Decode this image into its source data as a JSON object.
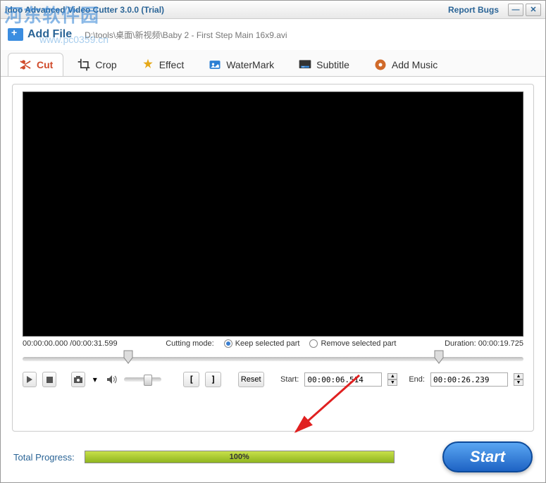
{
  "window": {
    "title": "idoo Advanced Video Cutter 3.0.0 (Trial)",
    "report_bugs": "Report Bugs"
  },
  "watermark": {
    "line1": "河东软件园",
    "line2": "www.pc0359.cn"
  },
  "toolbar": {
    "add_file": "Add File",
    "file_path": "D:\\tools\\桌面\\新视频\\Baby 2 - First Step Main 16x9.avi"
  },
  "tabs": {
    "cut": "Cut",
    "crop": "Crop",
    "effect": "Effect",
    "watermark": "WaterMark",
    "subtitle": "Subtitle",
    "add_music": "Add Music"
  },
  "player": {
    "current_time": "00:00:00.000",
    "total_time": "00:00:31.599",
    "cutting_mode_label": "Cutting mode:",
    "keep_label": "Keep selected part",
    "remove_label": "Remove selected part",
    "duration_label": "Duration:",
    "duration_value": "00:00:19.725",
    "reset": "Reset",
    "start_label": "Start:",
    "start_value": "00:00:06.514",
    "end_label": "End:",
    "end_value": "00:00:26.239",
    "bracket_left": "[",
    "bracket_right": "]"
  },
  "footer": {
    "progress_label": "Total Progress:",
    "progress_text": "100%",
    "progress_pct": 100,
    "start_button": "Start"
  }
}
